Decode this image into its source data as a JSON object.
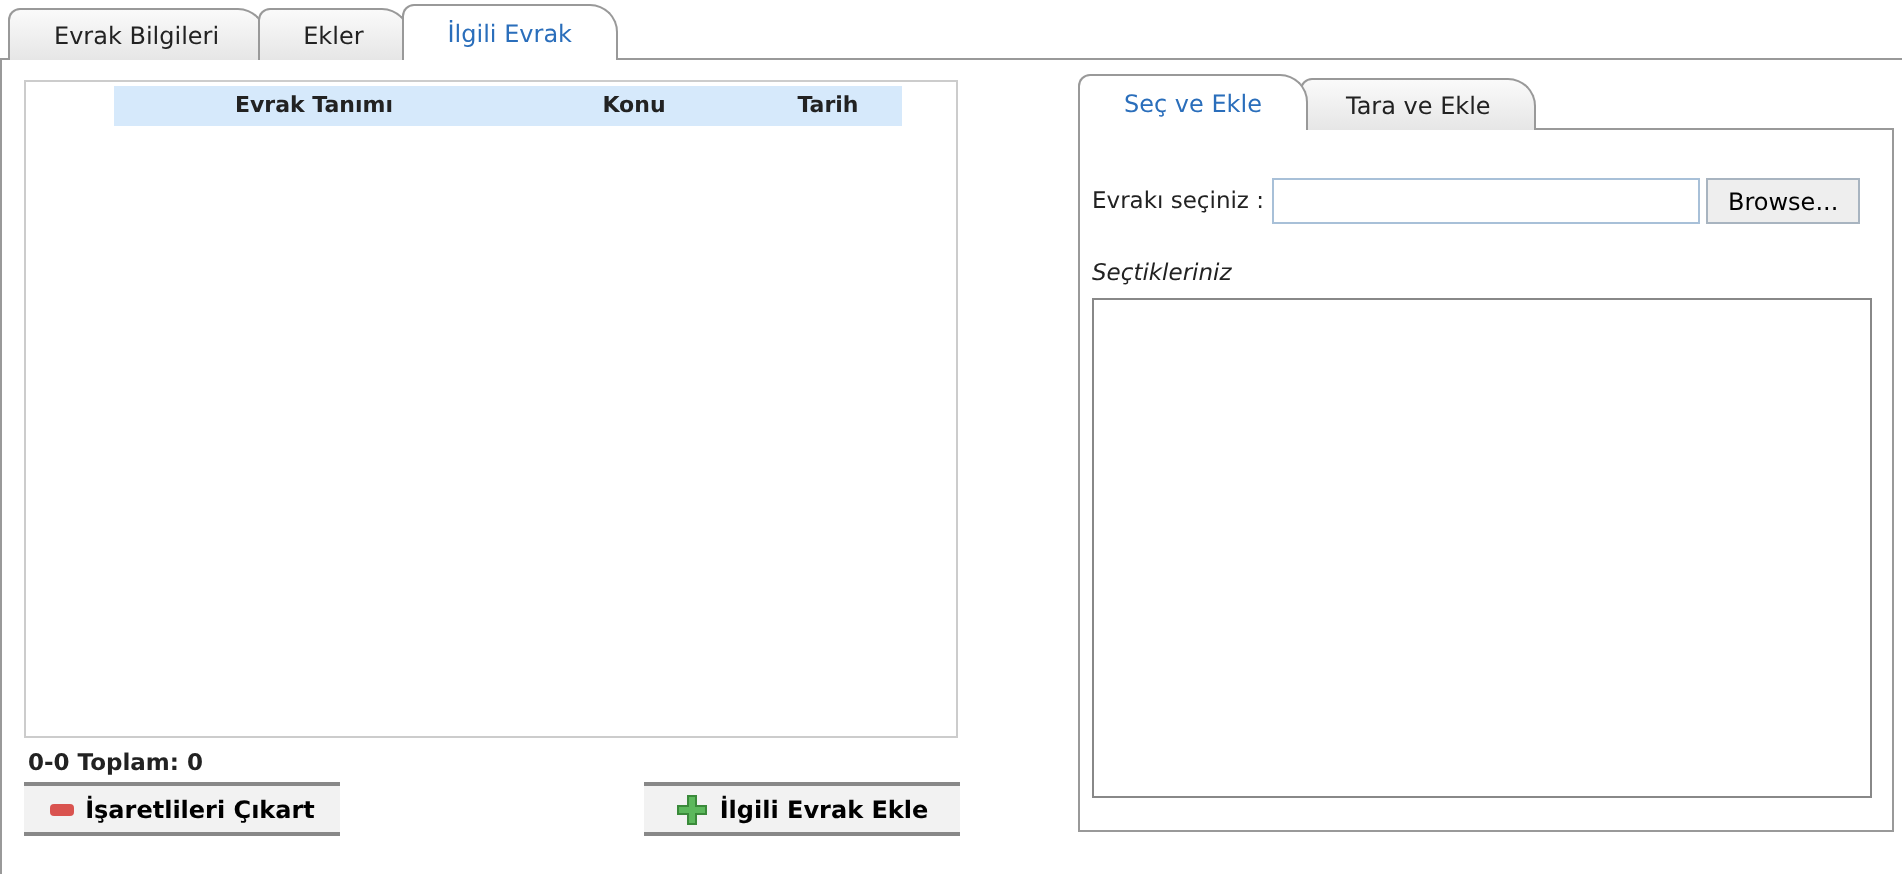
{
  "tabs": [
    {
      "label": "Evrak Bilgileri",
      "selected": false
    },
    {
      "label": "Ekler",
      "selected": false
    },
    {
      "label": "İlgili Evrak",
      "selected": true
    }
  ],
  "grid": {
    "columns": [
      "Evrak Tanımı",
      "Konu",
      "Tarih"
    ]
  },
  "pager": "0-0 Toplam: 0",
  "buttons": [
    {
      "label": "İşaretlileri Çıkart",
      "kind": "remove"
    },
    {
      "label": "İlgili Evrak Ekle",
      "kind": "add"
    }
  ],
  "upload": {
    "tabs": [
      {
        "label": "Seç ve Ekle",
        "selected": true
      },
      {
        "label": "Tara ve Ekle",
        "selected": false
      }
    ],
    "field_label": "Evrakı seçiniz :",
    "browse": "Browse...",
    "selected_label": "Seçtikleriniz"
  }
}
